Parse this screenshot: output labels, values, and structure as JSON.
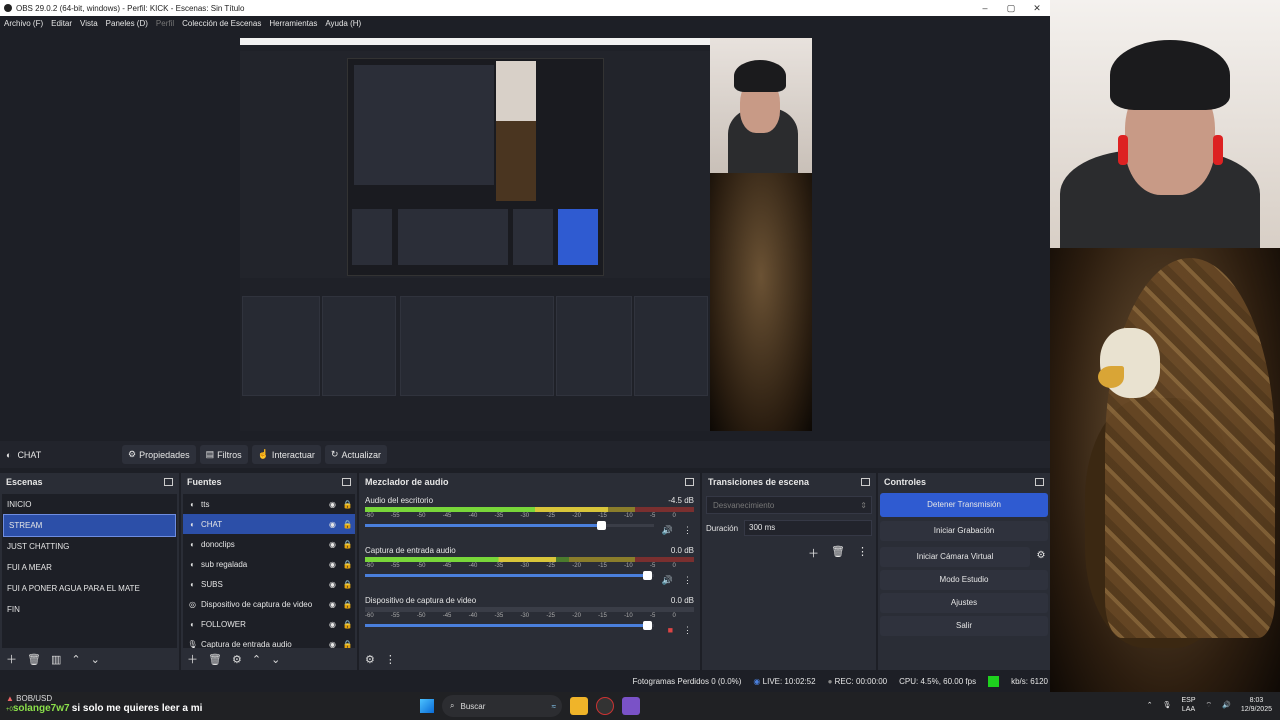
{
  "window": {
    "title": "OBS 29.0.2 (64-bit, windows) - Perfil: KICK - Escenas: Sin Título",
    "controls": [
      "–",
      "▢",
      "✕"
    ]
  },
  "menu": [
    "Archivo (F)",
    "Editar",
    "Vista",
    "Paneles (D)",
    "Perfil",
    "Colección de Escenas",
    "Herramientas",
    "Ayuda (H)"
  ],
  "source_toolbar": {
    "current_source": "CHAT",
    "properties": "Propiedades",
    "filters": "Filtros",
    "interact": "Interactuar",
    "refresh": "Actualizar"
  },
  "scenes": {
    "title": "Escenas",
    "items": [
      "INICIO",
      "STREAM",
      "JUST CHATTING",
      "FUI A MEAR",
      "FUI A PONER AGUA PARA EL MATE",
      "FIN"
    ],
    "selected": "STREAM"
  },
  "sources": {
    "title": "Fuentes",
    "items": [
      "tts",
      "CHAT",
      "donoclips",
      "sub regalada",
      "SUBS",
      "Dispositivo de captura de video",
      "FOLLOWER",
      "Captura de entrada audio"
    ],
    "selected": "CHAT"
  },
  "mixer": {
    "title": "Mezclador de audio",
    "tracks": [
      {
        "name": "Audio del escritorio",
        "db": "-4.5 dB",
        "level": 0.74,
        "volume": 0.82
      },
      {
        "name": "Captura de entrada audio",
        "db": "0.0 dB",
        "level": 0.58,
        "volume": 0.98
      },
      {
        "name": "Dispositivo de captura de video",
        "db": "0.0 dB",
        "level": 0.0,
        "volume": 0.98
      }
    ],
    "ticks": [
      "-60",
      "-55",
      "-50",
      "-45",
      "-40",
      "-35",
      "-30",
      "-25",
      "-20",
      "-15",
      "-10",
      "-5",
      "0"
    ]
  },
  "transitions": {
    "title": "Transiciones de escena",
    "type": "Desvanecimiento",
    "duration_label": "Duración",
    "duration_value": "300 ms"
  },
  "controls": {
    "title": "Controles",
    "stop_stream": "Detener Transmisión",
    "start_recording": "Iniciar Grabación",
    "virtual_cam": "Iniciar Cámara Virtual",
    "studio_mode": "Modo Estudio",
    "settings": "Ajustes",
    "exit": "Salir"
  },
  "status": {
    "dropped": "Fotogramas Perdidos 0 (0.0%)",
    "live": "LIVE: 10:02:52",
    "rec": "REC: 00:00:00",
    "cpu": "CPU: 4.5%, 60.00 fps",
    "kbps": "kb/s: 6120"
  },
  "taskbar": {
    "ticker": "BOB/USD",
    "ticker_sub": "+0",
    "chat_user": "solange7w7",
    "chat_msg": "si solo me quieres leer a mi",
    "search": "Buscar",
    "lang": "ESP",
    "lang_sub": "LAA",
    "time": "8:03",
    "date": "12/9/2025"
  }
}
